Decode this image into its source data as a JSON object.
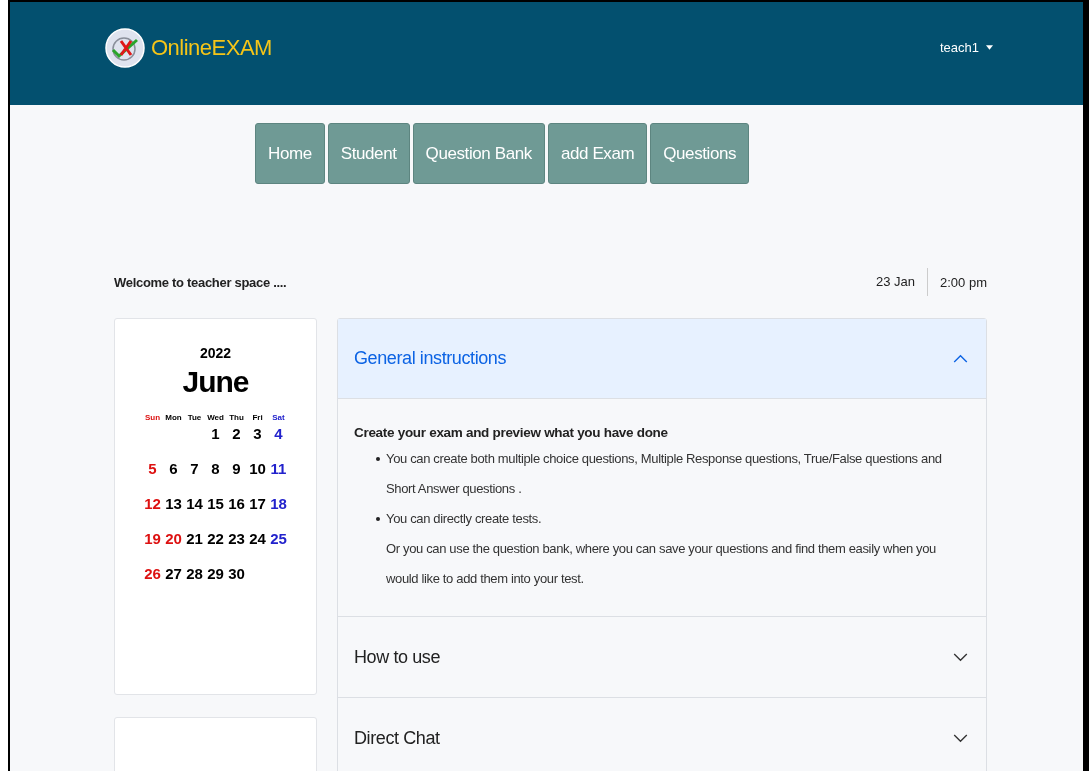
{
  "header": {
    "brand": "OnlineEXAM",
    "user_menu": "teach1"
  },
  "nav": [
    {
      "label": "Home"
    },
    {
      "label": "Student"
    },
    {
      "label": "Question Bank"
    },
    {
      "label": "add Exam"
    },
    {
      "label": "Questions"
    }
  ],
  "welcome": "Welcome to teacher space ....",
  "date": "23 Jan",
  "time": "2:00 pm",
  "calendar": {
    "year": "2022",
    "month": "June",
    "weekdays": [
      {
        "label": "Sun",
        "kind": "sun"
      },
      {
        "label": "Mon",
        "kind": "day"
      },
      {
        "label": "Tue",
        "kind": "day"
      },
      {
        "label": "Wed",
        "kind": "day"
      },
      {
        "label": "Thu",
        "kind": "day"
      },
      {
        "label": "Fri",
        "kind": "day"
      },
      {
        "label": "Sat",
        "kind": "sat"
      }
    ],
    "weeks": [
      [
        {
          "day": "1",
          "kind": "day"
        },
        {
          "day": "2",
          "kind": "day"
        },
        {
          "day": "3",
          "kind": "day"
        },
        {
          "day": "4",
          "kind": "sat"
        }
      ],
      [
        {
          "day": "5",
          "kind": "sun"
        },
        {
          "day": "6",
          "kind": "day"
        },
        {
          "day": "7",
          "kind": "day"
        },
        {
          "day": "8",
          "kind": "day"
        },
        {
          "day": "9",
          "kind": "day"
        },
        {
          "day": "10",
          "kind": "day"
        },
        {
          "day": "11",
          "kind": "sat"
        }
      ],
      [
        {
          "day": "12",
          "kind": "sun"
        },
        {
          "day": "13",
          "kind": "day"
        },
        {
          "day": "14",
          "kind": "day"
        },
        {
          "day": "15",
          "kind": "day"
        },
        {
          "day": "16",
          "kind": "day"
        },
        {
          "day": "17",
          "kind": "day"
        },
        {
          "day": "18",
          "kind": "sat"
        }
      ],
      [
        {
          "day": "19",
          "kind": "sun"
        },
        {
          "day": "20",
          "kind": "holiday"
        },
        {
          "day": "21",
          "kind": "day"
        },
        {
          "day": "22",
          "kind": "day"
        },
        {
          "day": "23",
          "kind": "day"
        },
        {
          "day": "24",
          "kind": "day"
        },
        {
          "day": "25",
          "kind": "sat"
        }
      ],
      [
        {
          "day": "26",
          "kind": "sun"
        },
        {
          "day": "27",
          "kind": "day"
        },
        {
          "day": "28",
          "kind": "day"
        },
        {
          "day": "29",
          "kind": "day"
        },
        {
          "day": "30",
          "kind": "day"
        }
      ]
    ]
  },
  "accordion": [
    {
      "title": "General instructions",
      "expanded": true,
      "heading": "Create your exam and preview what you have done",
      "bullets": [
        {
          "text": "You can create both multiple choice questions, Multiple Response questions, True/False questions and Short Answer questions ."
        },
        {
          "text": "You can directly create tests.",
          "note": "Or you can use the question bank, where you can save your questions and find them easily when you would like to add them into your test."
        }
      ]
    },
    {
      "title": "How to use",
      "expanded": false
    },
    {
      "title": "Direct Chat",
      "expanded": false
    }
  ]
}
